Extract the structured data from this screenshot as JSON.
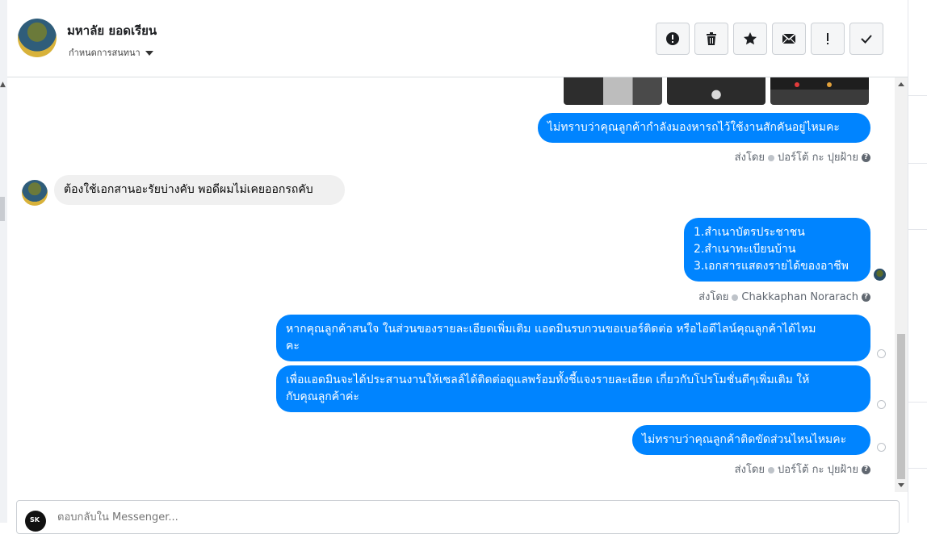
{
  "header": {
    "name": "มหาลัย ยอดเรียน",
    "subtitle": "กำหนดการสนทนา",
    "actions": [
      {
        "icon": "alert-circle-icon"
      },
      {
        "icon": "trash-icon"
      },
      {
        "icon": "star-icon"
      },
      {
        "icon": "envelope-icon"
      },
      {
        "icon": "exclamation-icon"
      },
      {
        "icon": "checkmark-icon"
      }
    ]
  },
  "messages": {
    "m1": "ไม่ทราบว่าคุณลูกค้ากำลังมองหารถไว้ใช้งานสักคันอยู่ไหมคะ",
    "sent1": {
      "prefix": "ส่งโดย",
      "sender": "ปอร์โต้ กะ ปุยฝ้าย"
    },
    "m2": "ต้องใช้เอกสานอะรัยบ่างคับ พอดีผมไม่เคยออกรถคับ",
    "m3": [
      "1.สำเนาบัตรประชาชน",
      "2.สำเนาทะเบียนบ้าน",
      "3.เอกสารแสดงรายได้ของอาชีพ"
    ],
    "sent2": {
      "prefix": "ส่งโดย",
      "sender": "Chakkaphan Norarach"
    },
    "m4": [
      "หากคุณลูกค้าสนใจ ในส่วนของรายละเอียดเพิ่มเติม แอดมินรบกวนขอเบอร์ติดต่อ หรือไอดีไลน์คุณลูกค้าได้ไหม",
      "คะ"
    ],
    "m5": [
      "เพื่อแอดมินจะได้ประสานงานให้เซลล์ได้ติดต่อดูแลพร้อมทั้งชี้แจงรายละเอียด เกี่ยวกับโปรโมชั่นดีๆเพิ่มเติม ให้",
      "กับคุณลูกค้าค่ะ"
    ],
    "m6": "ไม่ทราบว่าคุณลูกค้าติดขัดส่วนไหนไหมคะ",
    "sent3": {
      "prefix": "ส่งโดย",
      "sender": "ปอร์โต้ กะ ปุยฝ้าย"
    }
  },
  "composer": {
    "placeholder": "ตอบกลับใน Messenger..."
  },
  "colors": {
    "outgoing_bubble": "#0084ff",
    "incoming_bubble": "#f0f0f0"
  }
}
